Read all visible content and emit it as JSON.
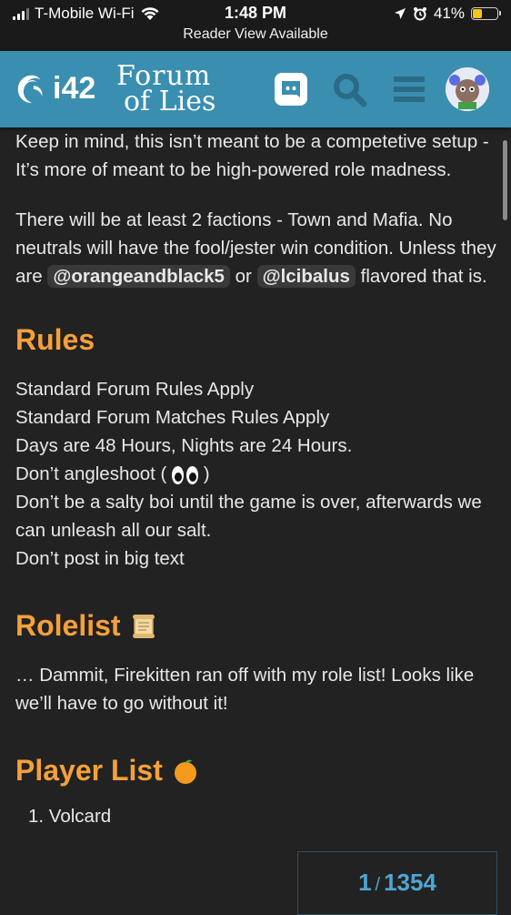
{
  "status_bar": {
    "carrier": "T-Mobile Wi-Fi",
    "time": "1:48 PM",
    "battery": "41%",
    "battery_level": 0.41,
    "reader_view": "Reader View Available"
  },
  "header": {
    "logo_i42": "i42",
    "logo_line1": "Forum",
    "logo_line2": "of Lies",
    "brand_color": "#3a8eb0"
  },
  "post": {
    "intro": "Keep in mind, this isn’t meant to be a competetive setup - It’s more of meant to be high-powered role madness.",
    "factions_line1": "There will be at least 2 factions - Town and Mafia. No neutrals will have the fool/jester win condition. Unless they are",
    "mention1": "@orangeandblack5",
    "or_text": "or",
    "mention2": "@lcibalus",
    "flavored": "flavored that is.",
    "rules_heading": "Rules",
    "rules": [
      "Standard Forum Rules Apply",
      "Standard Forum Matches Rules Apply",
      "Days are 48 Hours, Nights are 24 Hours.",
      "Don’t angleshoot (",
      ")",
      "Don’t be a salty boi until the game is over, afterwards we can unleash all our salt.",
      "Don’t post in big text"
    ],
    "rolelist_heading": "Rolelist",
    "rolelist_text": "… Dammit, Firekitten ran off with my role list! Looks like we’ll have to go without it!",
    "playerlist_heading": "Player List",
    "first_player": "1. Volcard"
  },
  "progress": {
    "current": "1",
    "total": "1354",
    "separator": "/"
  },
  "accent_color": "#f5a03c"
}
